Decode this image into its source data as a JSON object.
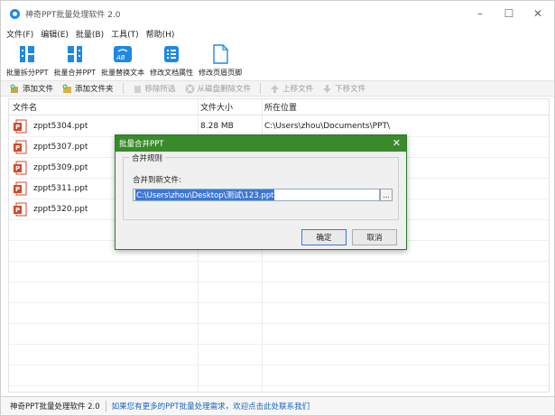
{
  "window": {
    "title": "神奇PPT批量处理软件 2.0",
    "controls": {
      "minimize": "–",
      "maximize": "☐",
      "close": "✕"
    }
  },
  "menu": [
    "文件(F)",
    "编辑(E)",
    "批量(B)",
    "工具(T)",
    "帮助(H)"
  ],
  "ribbon": [
    {
      "label": "批量拆分PPT",
      "icon": "split-icon"
    },
    {
      "label": "批量合并PPT",
      "icon": "merge-icon"
    },
    {
      "label": "批量替换文本",
      "icon": "replace-text-icon"
    },
    {
      "label": "修改文档属性",
      "icon": "doc-properties-icon"
    },
    {
      "label": "修改页眉页脚",
      "icon": "header-footer-icon"
    }
  ],
  "toolbar": {
    "add_file": "添加文件",
    "add_folder": "添加文件夹",
    "remove_selected": "移除所选",
    "delete_from_disk": "从磁盘删除文件",
    "move_up": "上移文件",
    "move_down": "下移文件"
  },
  "table": {
    "headers": [
      "文件名",
      "文件大小",
      "所在位置"
    ],
    "rows": [
      {
        "name": "zppt5304.ppt",
        "size": "8.28 MB",
        "path": "C:\\Users\\zhou\\Documents\\PPT\\"
      },
      {
        "name": "zppt5307.ppt",
        "size": "",
        "path": ""
      },
      {
        "name": "zppt5309.ppt",
        "size": "",
        "path": ""
      },
      {
        "name": "zppt5311.ppt",
        "size": "",
        "path": ""
      },
      {
        "name": "zppt5320.ppt",
        "size": "",
        "path": ""
      }
    ]
  },
  "dialog": {
    "title": "批量合并PPT",
    "group_label": "合并规则",
    "field_label": "合并到新文件:",
    "path_value": "C:\\Users\\zhou\\Desktop\\测试\\123.ppt",
    "browse": "...",
    "ok": "确定",
    "cancel": "取消"
  },
  "status": {
    "app": "神奇PPT批量处理软件 2.0",
    "message": "如果您有更多的PPT批量处理需求，欢迎点击此处联系我们"
  },
  "colors": {
    "accent": "#1e88e5",
    "dialog_title": "#3a8a2c",
    "link": "#1565c0",
    "selection": "#3d77d6"
  }
}
